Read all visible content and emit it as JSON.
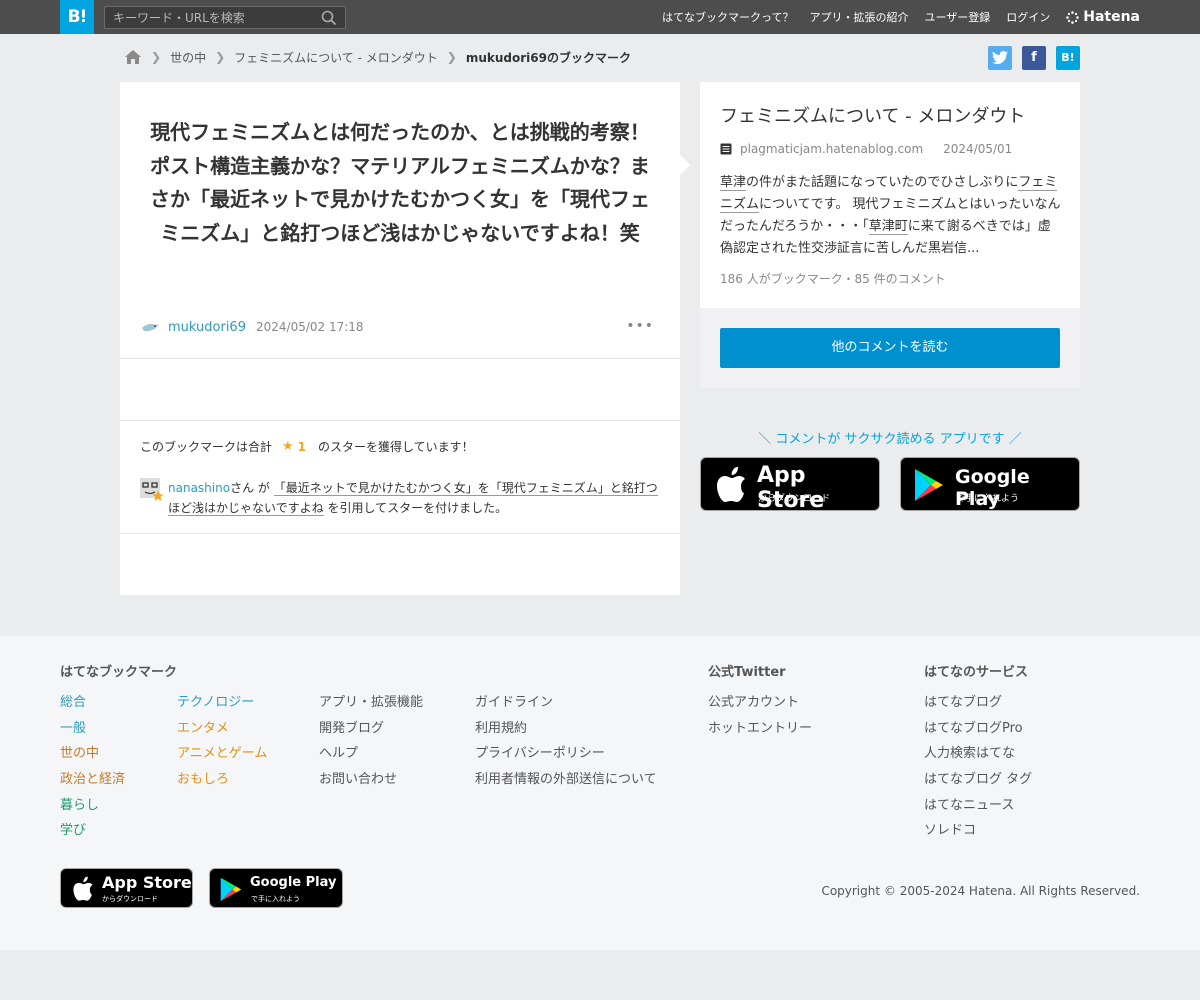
{
  "header": {
    "logo": "B!",
    "search_placeholder": "キーワード・URLを検索",
    "nav": [
      "はてなブックマークって？",
      "アプリ・拡張の紹介",
      "ユーザー登録",
      "ログイン"
    ],
    "brand": "Hatena"
  },
  "breadcrumb": [
    "世の中",
    "フェミニズムについて - メロンダウト",
    "mukudori69のブックマーク"
  ],
  "share": {
    "twitter": "t",
    "facebook": "f",
    "hatena": "B!"
  },
  "comment": {
    "text": "現代フェミニズムとは何だったのか、とは挑戦的考察！ポスト構造主義かな？マテリアルフェミニズムかな？まさか「最近ネットで見かけたむかつく女」を「現代フェミニズム」と銘打つほど浅はかじゃないですよね！笑",
    "user": "mukudori69",
    "date": "2024/05/02 17:18",
    "more": "•••"
  },
  "stars": {
    "prefix": "このブックマークは合計",
    "star_icon": "★",
    "count": "1",
    "suffix": "のスターを獲得しています！"
  },
  "quote": {
    "user": "nanashino",
    "san": "さん が",
    "quoted": "「最近ネットで見かけたむかつく女」を「現代フェミニズム」と銘打つほど浅はかじゃないですよね",
    "tail": "を引用してスターを付けました。"
  },
  "entry": {
    "title": "フェミニズムについて - メロンダウト",
    "domain": "plagmaticjam.hatenablog.com",
    "date": "2024/05/01",
    "desc_1": "草津",
    "desc_2": "の件がまた話題になっていたのでひさしぶりに",
    "desc_3": "フェミニズム",
    "desc_4": "についてです。 現代フェミニズムとはいったいなんだったんだろうか・・・「",
    "desc_5": "草津町",
    "desc_6": "に来て謝るべきでは」虚偽認定された性交渉証言に苦しんだ黒岩信...",
    "stats": "186 人がブックマーク・85 件のコメント",
    "button": "他のコメントを読む"
  },
  "app_promo": "＼ コメントが サクサク読める アプリです ／",
  "stores": {
    "apple_big": "App Store",
    "apple_small": "からダウンロード",
    "google_big": "Google Play",
    "google_small": "で手に入れよう"
  },
  "footer": {
    "heading_bookmark": "はてなブックマーク",
    "heading_twitter": "公式Twitter",
    "heading_services": "はてなのサービス",
    "cats_1": [
      "総合",
      "一般",
      "世の中",
      "政治と経済",
      "暮らし",
      "学び"
    ],
    "cats_2": [
      "テクノロジー",
      "エンタメ",
      "アニメとゲーム",
      "おもしろ"
    ],
    "links_1": [
      "アプリ・拡張機能",
      "開発ブログ",
      "ヘルプ",
      "お問い合わせ"
    ],
    "links_2": [
      "ガイドライン",
      "利用規約",
      "プライバシーポリシー",
      "利用者情報の外部送信について"
    ],
    "twitter": [
      "公式アカウント",
      "ホットエントリー"
    ],
    "services": [
      "はてなブログ",
      "はてなブログPro",
      "人力検索はてな",
      "はてなブログ タグ",
      "はてなニュース",
      "ソレドコ"
    ],
    "copyright": "Copyright © 2005-2024 Hatena. All Rights Reserved."
  },
  "colors": {
    "brand_blue": "#00a4de",
    "button_blue": "#0090d0",
    "star": "#f5a623"
  }
}
